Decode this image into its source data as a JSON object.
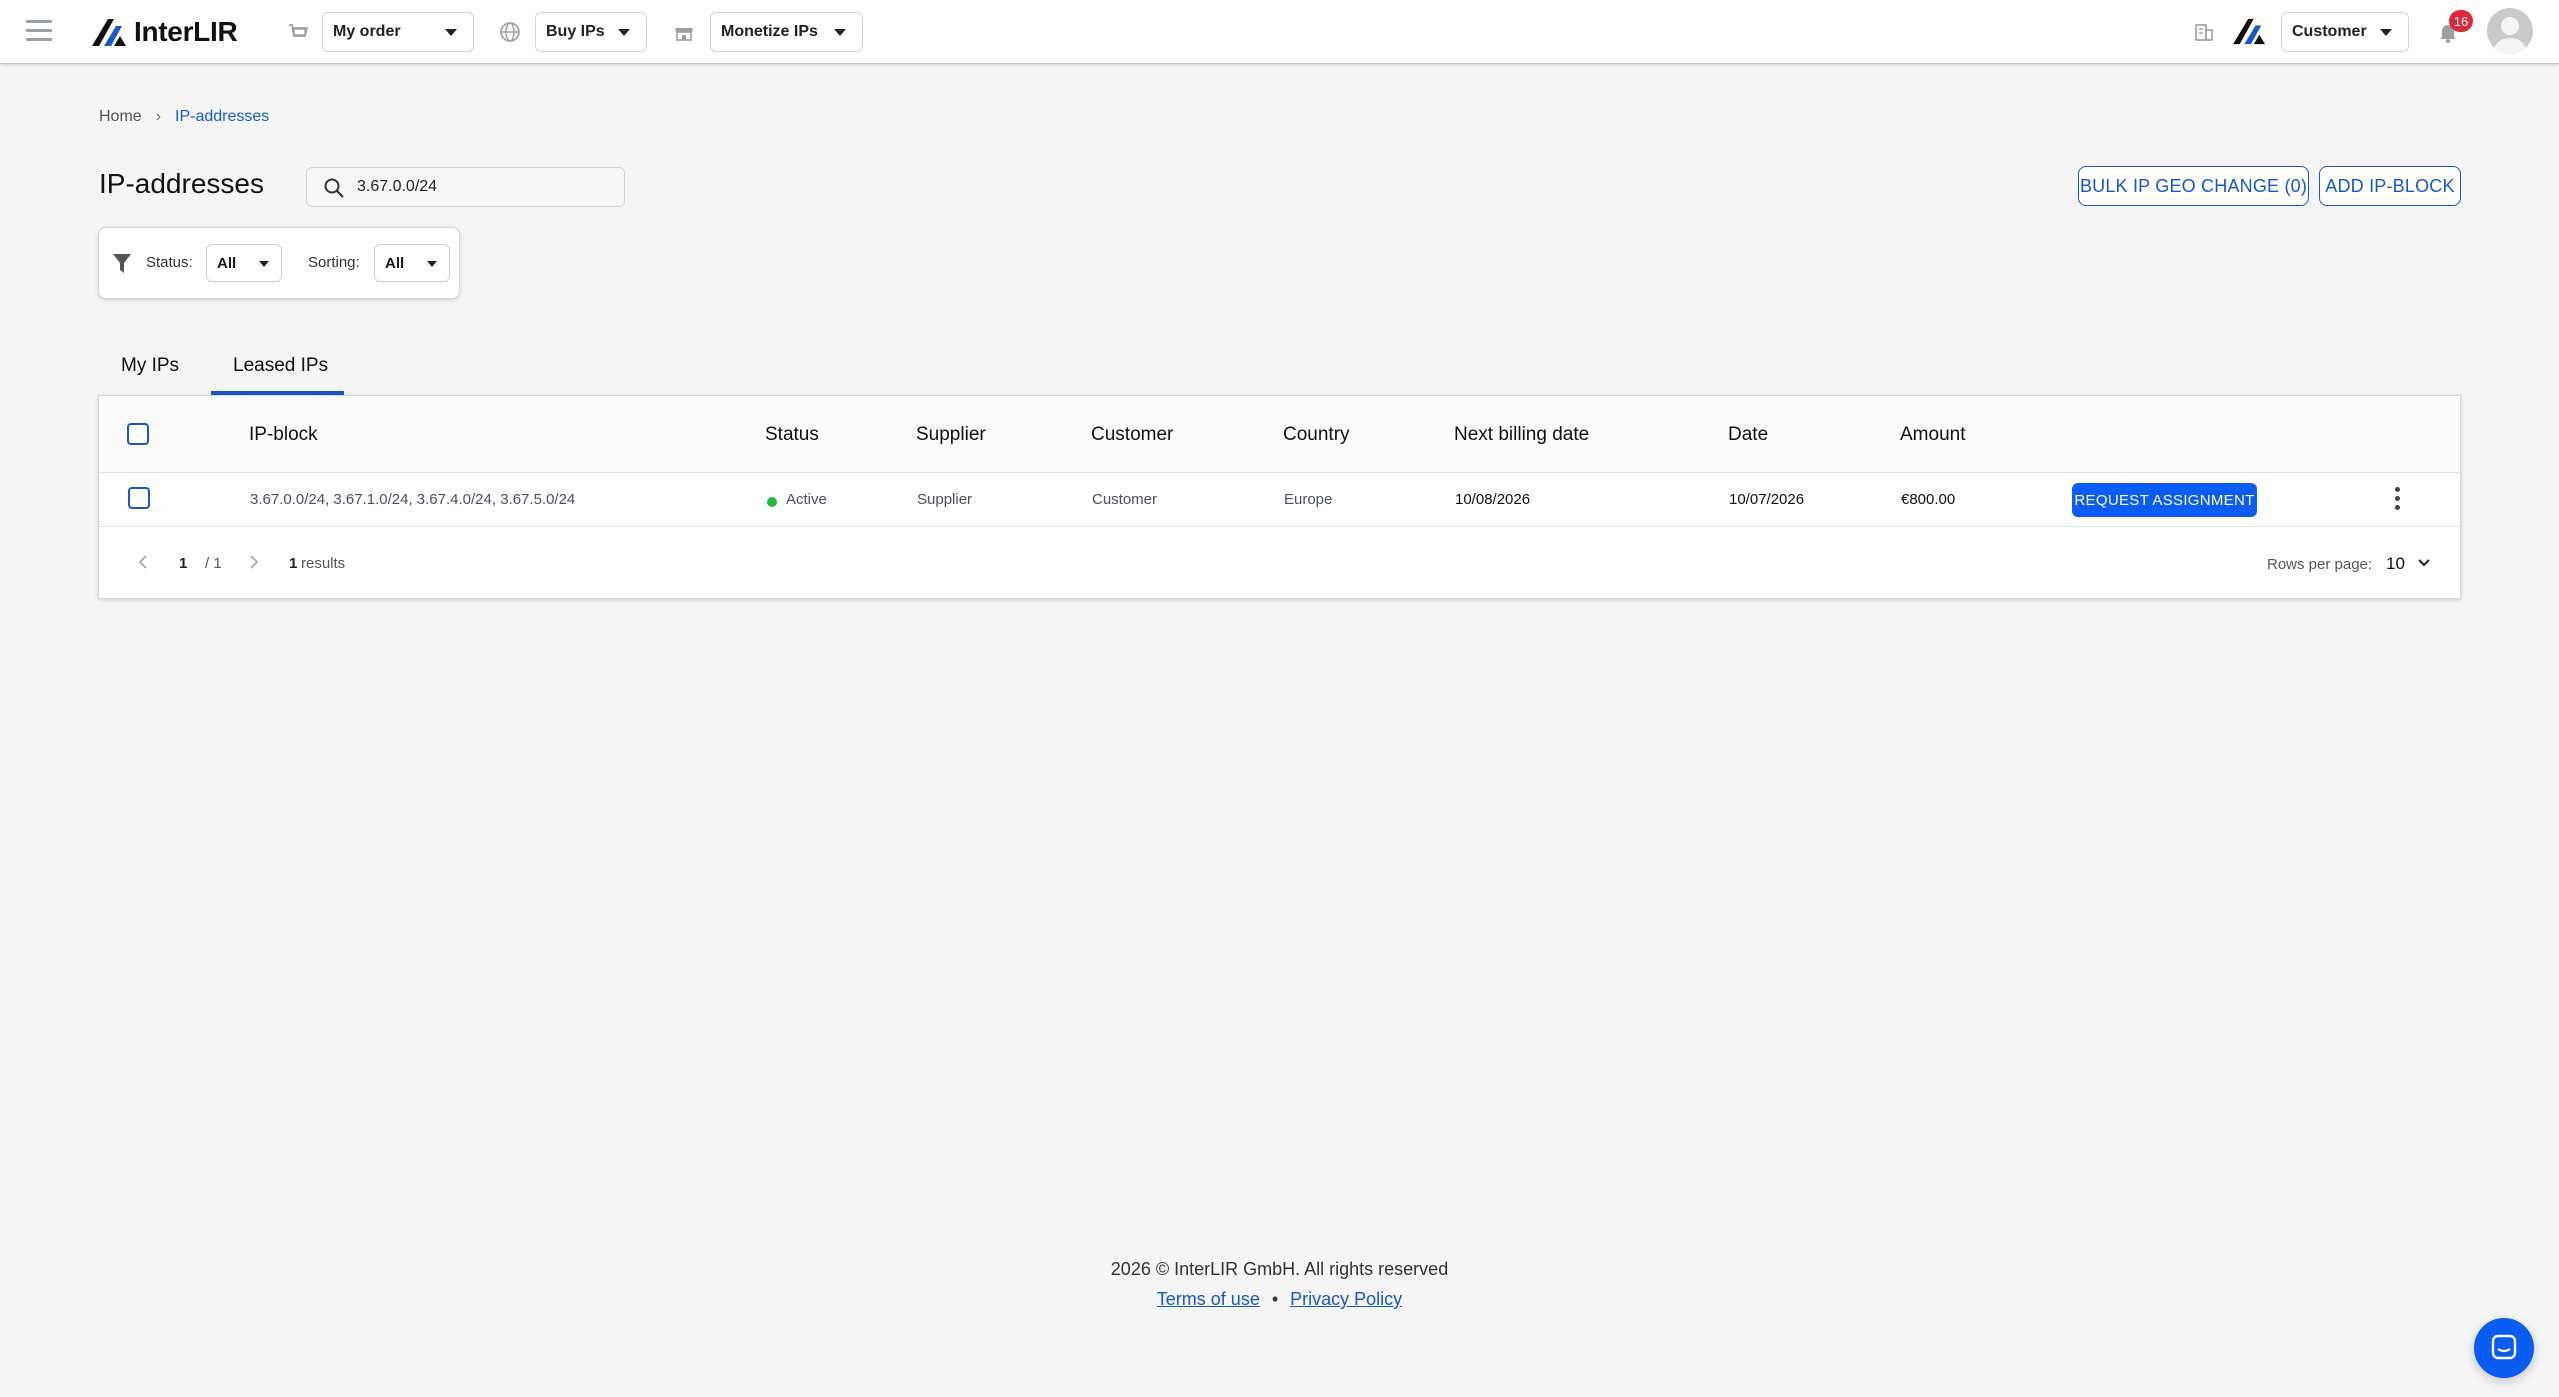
{
  "app": {
    "brand": "InterLIR",
    "nav": {
      "my_order": "My order",
      "buy_ips": "Buy IPs",
      "monetize_ips": "Monetize IPs",
      "role": "Customer",
      "notifications_count": "16"
    }
  },
  "breadcrumb": {
    "home": "Home",
    "current": "IP-addresses"
  },
  "page": {
    "title": "IP-addresses",
    "search_value": "3.67.0.0/24",
    "bulk_button": "BULK IP GEO CHANGE (0)",
    "add_button": "ADD IP-BLOCK"
  },
  "filters": {
    "status_label": "Status:",
    "status_value": "All",
    "sorting_label": "Sorting:",
    "sorting_value": "All"
  },
  "tabs": {
    "my_ips": "My IPs",
    "leased_ips": "Leased IPs",
    "active_tab": "Leased IPs"
  },
  "table": {
    "columns": [
      "IP-block",
      "Status",
      "Supplier",
      "Customer",
      "Country",
      "Next billing date",
      "Date",
      "Amount"
    ],
    "rows": [
      {
        "ip_block": "3.67.0.0/24, 3.67.1.0/24, 3.67.4.0/24, 3.67.5.0/24",
        "status": "Active",
        "supplier": "Supplier",
        "customer": "Customer",
        "country": "Europe",
        "next_billing_date": "10/08/2026",
        "date": "10/07/2026",
        "amount": "€800.00",
        "action": "REQUEST ASSIGNMENT"
      }
    ],
    "pager": {
      "page": "1",
      "total_pages": "/ 1",
      "results_count": "1",
      "results_label": "results",
      "rows_per_page_label": "Rows per page:",
      "rows_per_page": "10"
    }
  },
  "footer": {
    "copyright": "2026 © InterLIR GmbH. All rights reserved",
    "terms": "Terms of use",
    "separator": "•",
    "privacy": "Privacy Policy"
  },
  "colors": {
    "accent": "#1a56c9",
    "primary_button": "#0b5cf2",
    "status_active": "#1fbf3a",
    "badge": "#e0283c"
  }
}
